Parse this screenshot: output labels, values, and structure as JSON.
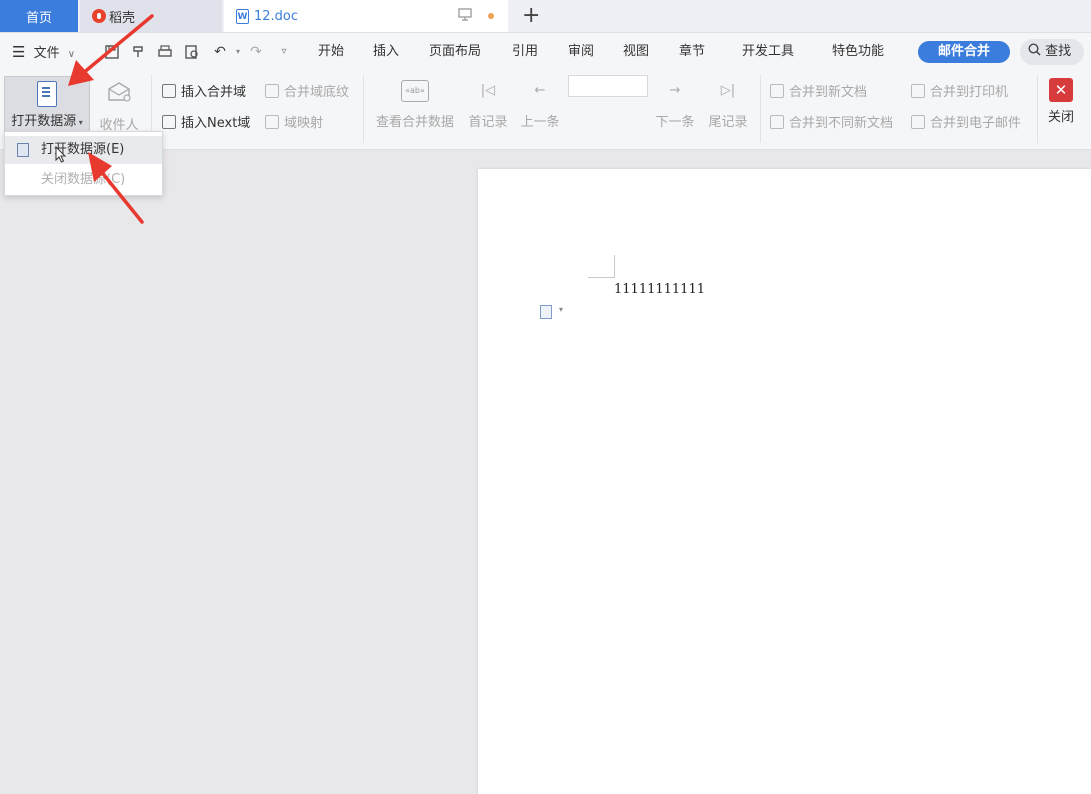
{
  "tabs": {
    "home": "首页",
    "daoke": "稻壳",
    "doc": "12.doc",
    "doc_icon_letter": "W",
    "new_tab": "+"
  },
  "menu": {
    "file": "文件",
    "items": [
      "开始",
      "插入",
      "页面布局",
      "引用",
      "审阅",
      "视图",
      "章节",
      "开发工具",
      "特色功能"
    ],
    "active_tab": "邮件合并",
    "search": "查找"
  },
  "ribbon": {
    "open_datasource": "打开数据源",
    "recipients": "收件人",
    "insert_merge_field": "插入合并域",
    "merge_field_shading": "合并域底纹",
    "insert_next_field": "插入Next域",
    "field_mapping": "域映射",
    "view_merged_data": "查看合并数据",
    "first_record": "首记录",
    "prev_record": "上一条",
    "next_record": "下一条",
    "last_record": "尾记录",
    "merge_new_doc": "合并到新文档",
    "merge_diff_doc": "合并到不同新文档",
    "merge_printer": "合并到打印机",
    "merge_email": "合并到电子邮件",
    "close": "关闭"
  },
  "dropdown": {
    "open": "打开数据源(E)",
    "close": "关闭数据源(C)"
  },
  "document": {
    "text": "11111111111"
  },
  "colors": {
    "accent": "#3b7ddd",
    "annotation_arrow": "#e8392f",
    "close_button": "#d83b3b"
  }
}
